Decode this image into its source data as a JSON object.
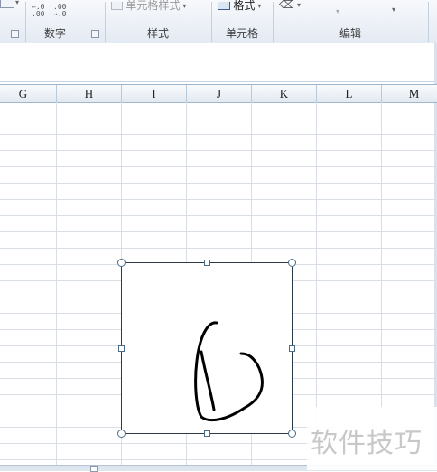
{
  "ribbon": {
    "groups": {
      "number": {
        "label": "数字"
      },
      "styles": {
        "label": "样式",
        "cell_styles_label": "单元格样式"
      },
      "cells": {
        "label": "单元格",
        "format_label": "格式"
      },
      "editing": {
        "label": "编辑"
      }
    },
    "increase_decimal": {
      "top": "←.0",
      "bottom": ".00"
    },
    "decrease_decimal": {
      "top": ".00",
      "bottom": "→.0"
    }
  },
  "columns": [
    "G",
    "H",
    "I",
    "J",
    "K",
    "L",
    "M"
  ],
  "watermark": {
    "text": "软件技巧"
  },
  "colors": {
    "ribbon_bg": "#e4eaf3",
    "header_border": "#9eb6ce",
    "gridline": "#dadfe6",
    "ink": "#000000"
  }
}
